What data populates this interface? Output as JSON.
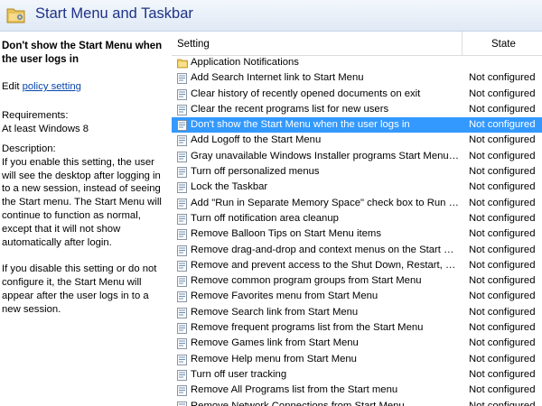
{
  "header": {
    "title": "Start Menu and Taskbar",
    "icon": "folder-settings-icon"
  },
  "details": {
    "policy_title": "Don't show the Start Menu when the user logs in",
    "edit_prefix": "Edit",
    "edit_link": "policy setting",
    "requirements_label": "Requirements:",
    "requirements_value": "At least Windows 8",
    "description_label": "Description:",
    "description_p1": "If you enable this setting, the user will see the desktop after logging in to a new session, instead of seeing the Start menu. The Start Menu will continue to function as normal, except that it will not show automatically after login.",
    "description_p2": "If you disable this setting or do not configure it, the Start Menu will appear after the user logs in to a new session."
  },
  "columns": {
    "setting": "Setting",
    "state": "State"
  },
  "rows": [
    {
      "name": "Application Notifications",
      "state": "",
      "type": "folder"
    },
    {
      "name": "Add Search Internet link to Start Menu",
      "state": "Not configured",
      "type": "policy"
    },
    {
      "name": "Clear history of recently opened documents on exit",
      "state": "Not configured",
      "type": "policy"
    },
    {
      "name": "Clear the recent programs list for new users",
      "state": "Not configured",
      "type": "policy"
    },
    {
      "name": "Don't show the Start Menu when the user logs in",
      "state": "Not configured",
      "type": "policy",
      "selected": true
    },
    {
      "name": "Add Logoff to the Start Menu",
      "state": "Not configured",
      "type": "policy"
    },
    {
      "name": "Gray unavailable Windows Installer programs Start Menu sh...",
      "state": "Not configured",
      "type": "policy"
    },
    {
      "name": "Turn off personalized menus",
      "state": "Not configured",
      "type": "policy"
    },
    {
      "name": "Lock the Taskbar",
      "state": "Not configured",
      "type": "policy"
    },
    {
      "name": "Add \"Run in Separate Memory Space\" check box to Run dial...",
      "state": "Not configured",
      "type": "policy"
    },
    {
      "name": "Turn off notification area cleanup",
      "state": "Not configured",
      "type": "policy"
    },
    {
      "name": "Remove Balloon Tips on Start Menu items",
      "state": "Not configured",
      "type": "policy"
    },
    {
      "name": "Remove drag-and-drop and context menus on the Start Me...",
      "state": "Not configured",
      "type": "policy"
    },
    {
      "name": "Remove and prevent access to the Shut Down, Restart, Sleep...",
      "state": "Not configured",
      "type": "policy"
    },
    {
      "name": "Remove common program groups from Start Menu",
      "state": "Not configured",
      "type": "policy"
    },
    {
      "name": "Remove Favorites menu from Start Menu",
      "state": "Not configured",
      "type": "policy"
    },
    {
      "name": "Remove Search link from Start Menu",
      "state": "Not configured",
      "type": "policy"
    },
    {
      "name": "Remove frequent programs list from the Start Menu",
      "state": "Not configured",
      "type": "policy"
    },
    {
      "name": "Remove Games link from Start Menu",
      "state": "Not configured",
      "type": "policy"
    },
    {
      "name": "Remove Help menu from Start Menu",
      "state": "Not configured",
      "type": "policy"
    },
    {
      "name": "Turn off user tracking",
      "state": "Not configured",
      "type": "policy"
    },
    {
      "name": "Remove All Programs list from the Start menu",
      "state": "Not configured",
      "type": "policy"
    },
    {
      "name": "Remove Network Connections from Start Menu",
      "state": "Not configured",
      "type": "policy"
    }
  ],
  "colors": {
    "selection": "#3399ff",
    "title_text": "#1e3287",
    "link": "#0645ad"
  }
}
